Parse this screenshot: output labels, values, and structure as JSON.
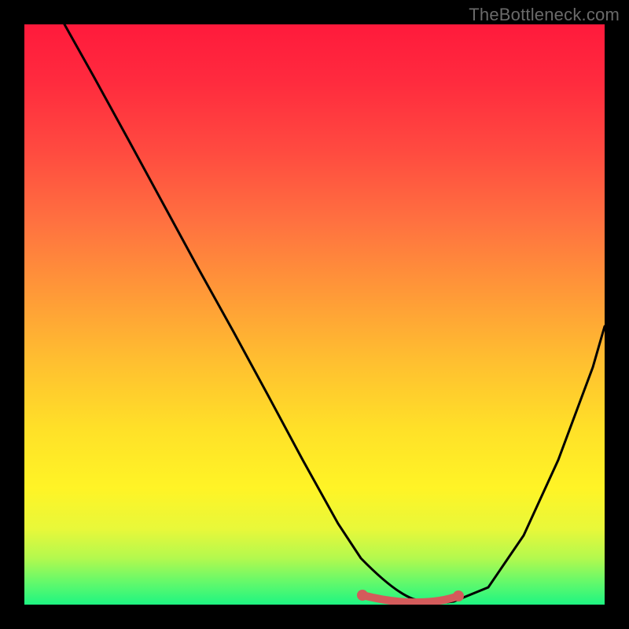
{
  "watermark": "TheBottleneck.com",
  "chart_data": {
    "type": "line",
    "title": "",
    "xlabel": "",
    "ylabel": "",
    "xlim": [
      0,
      100
    ],
    "ylim": [
      0,
      100
    ],
    "series": [
      {
        "name": "curve",
        "x": [
          7,
          12,
          18,
          24,
          30,
          36,
          42,
          48,
          54,
          58,
          62,
          66,
          70,
          74,
          80,
          86,
          92,
          98,
          100
        ],
        "y": [
          100,
          91,
          80,
          69,
          58,
          47,
          36,
          25,
          14,
          8,
          4,
          1.5,
          0.5,
          0.5,
          3,
          12,
          25,
          41,
          48
        ]
      }
    ],
    "minimum_band": {
      "x_start": 58,
      "x_end": 74,
      "y": 1
    },
    "gradient": {
      "top_color": "#ff1a3c",
      "mid_color": "#ffe128",
      "bottom_color": "#1ef582"
    }
  }
}
